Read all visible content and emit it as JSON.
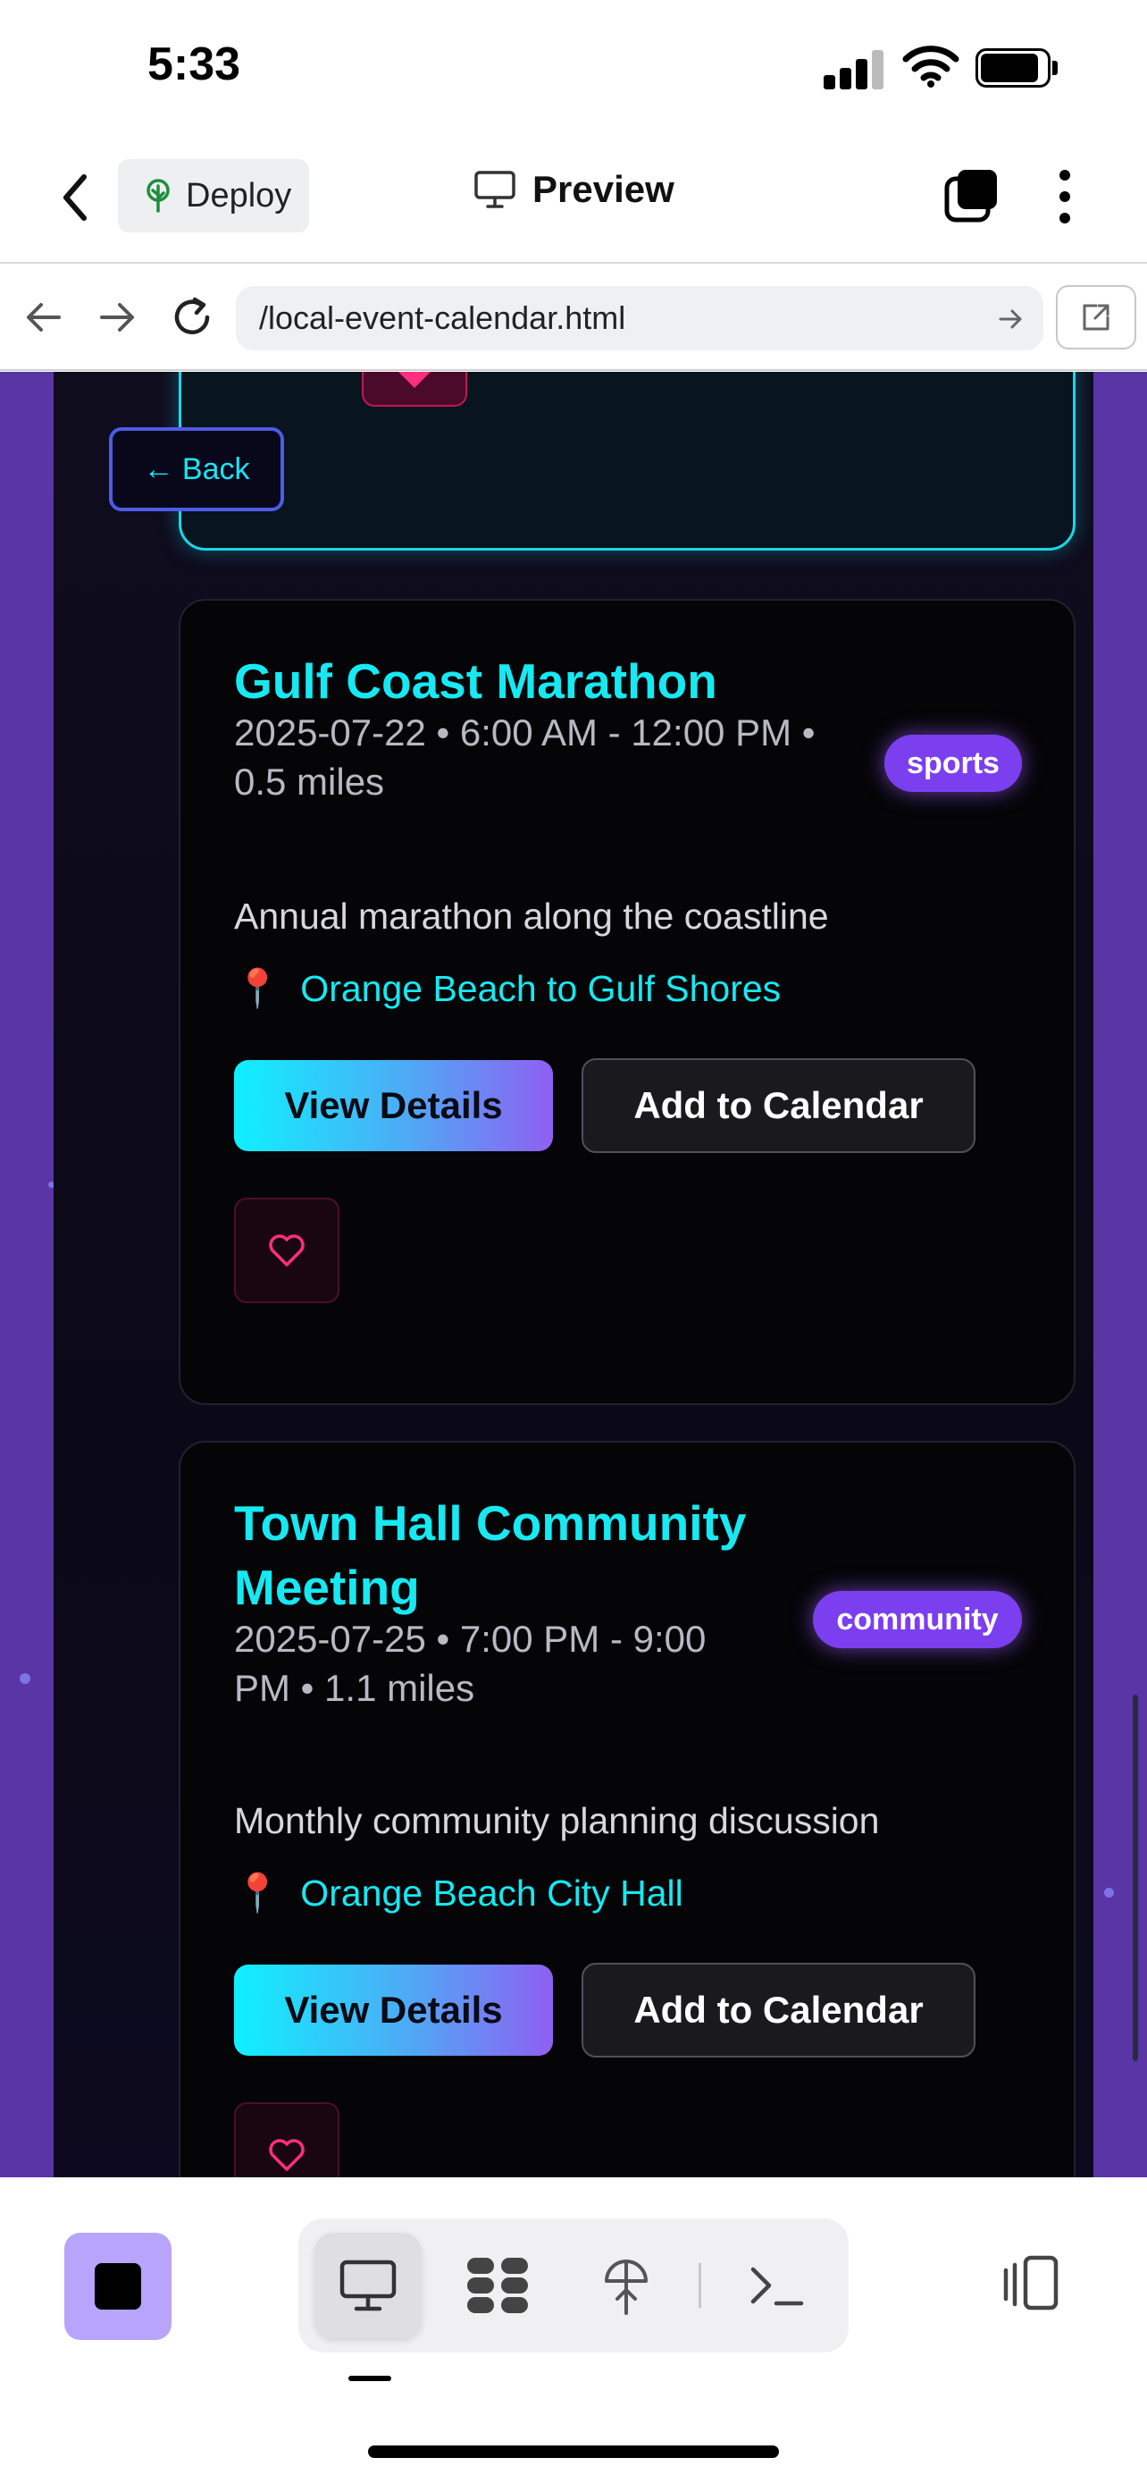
{
  "status_bar": {
    "time": "5:33"
  },
  "toolbar": {
    "deploy_label": "Deploy",
    "preview_label": "Preview"
  },
  "url_bar": {
    "url": "/local-event-calendar.html"
  },
  "page": {
    "back_label": "← Back",
    "events": [
      {
        "title_lines": [
          "Gulf Coast Marathon"
        ],
        "meta_lines": [
          "2025-07-22 • 6:00 AM - 12:00 PM •",
          "0.5 miles"
        ],
        "category": "sports",
        "description": "Annual marathon along the coastline",
        "location": "Orange Beach to Gulf Shores",
        "view_label": "View Details",
        "calendar_label": "Add to Calendar"
      },
      {
        "title_lines": [
          "Town Hall Community",
          "Meeting"
        ],
        "meta_lines": [
          "2025-07-25 • 7:00 PM - 9:00",
          "PM • 1.1 miles"
        ],
        "category": "community",
        "description": "Monthly community planning discussion",
        "location": "Orange Beach City Hall",
        "view_label": "View Details",
        "calendar_label": "Add to Calendar"
      }
    ]
  },
  "colors": {
    "accent_cyan": "#16e9f2",
    "badge_purple": "#7b3ff0",
    "favorite_pink": "#ff2e7e",
    "outer_purple": "#5a35a6"
  },
  "icons": {
    "back": "chevron-left-icon",
    "deploy": "tree-icon",
    "preview": "monitor-icon",
    "tabs": "tabs-icon",
    "more": "more-vertical-icon",
    "favorite": "heart-icon",
    "location": "pin-icon"
  }
}
